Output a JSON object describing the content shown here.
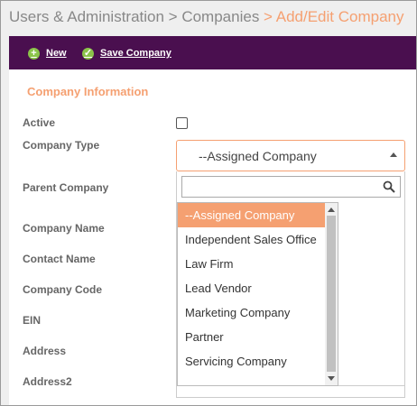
{
  "breadcrumb": {
    "path": "Users & Administration > Companies",
    "current": " > Add/Edit Company"
  },
  "toolbar": {
    "new_label": "New",
    "save_label": "Save Company"
  },
  "section": {
    "title": "Company Information"
  },
  "form": {
    "active_label": "Active",
    "active_checked": false,
    "company_type_label": "Company Type",
    "company_type_value": "--Assigned Company",
    "parent_company_label": "Parent Company",
    "company_name_label": "Company Name",
    "contact_name_label": "Contact Name",
    "company_code_label": "Company Code",
    "ein_label": "EIN",
    "address_label": "Address",
    "address2_label": "Address2"
  },
  "dropdown": {
    "search_value": "",
    "options": [
      "--Assigned Company",
      "Independent Sales Office",
      "Law Firm",
      "Lead Vendor",
      "Marketing Company",
      "Partner",
      "Servicing Company"
    ],
    "selected_index": 0
  },
  "colors": {
    "accent": "#f5a071",
    "toolbar_bg": "#4a0f4f",
    "icon_green": "#8bc34a"
  }
}
